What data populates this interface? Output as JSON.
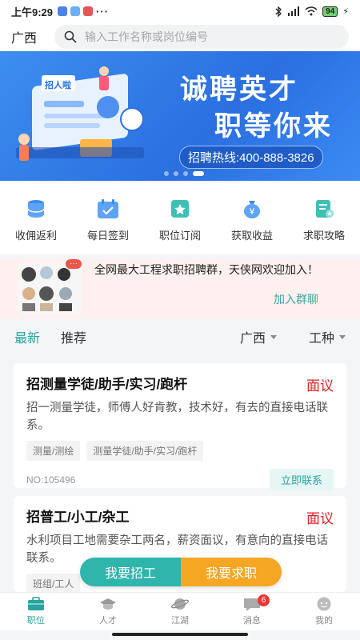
{
  "status_bar": {
    "time": "上午9:29",
    "battery": "94"
  },
  "header": {
    "city": "广西",
    "search_placeholder": "输入工作名称或岗位编号"
  },
  "banner": {
    "title_line1": "诚聘英才",
    "title_line2": "职等你来",
    "hotline": "招聘热线:400-888-3826",
    "illustration_sign": "招人啦"
  },
  "quick_menu": [
    {
      "label": "收佣返利",
      "icon": "database-icon",
      "color": "#3d8bf0"
    },
    {
      "label": "每日签到",
      "icon": "calendar-check-icon",
      "color": "#3d8bf0"
    },
    {
      "label": "职位订阅",
      "icon": "star-badge-icon",
      "color": "#2fb5ac"
    },
    {
      "label": "获取收益",
      "icon": "money-bag-icon",
      "color": "#3d8bf0"
    },
    {
      "label": "求职攻略",
      "icon": "document-star-icon",
      "color": "#2fb5ac"
    }
  ],
  "group_promo": {
    "text": "全网最大工程求职招聘群，天侠网欢迎加入！",
    "join_label": "加入群聊",
    "badge": "···"
  },
  "tabs": {
    "latest": "最新",
    "recommend": "推荐",
    "region_filter": "广西",
    "type_filter": "工种"
  },
  "jobs": [
    {
      "title": "招测量学徒/助手/实习/跑杆",
      "salary": "面议",
      "description": "招一测量学徒，师傅人好肯教，技术好，有去的直接电话联系。",
      "tags": [
        "测量/测绘",
        "测量学徒/助手/实习/跑杆"
      ],
      "number": "NO:105496",
      "contact_label": "立即联系"
    },
    {
      "title": "招普工/小工/杂工",
      "salary": "面议",
      "description": "水利项目工地需要杂工两名，薪资面议，有意向的直接电话联系。",
      "tags": [
        "班组/工人"
      ]
    }
  ],
  "fab": {
    "hire_label": "我要招工",
    "seek_label": "我要求职"
  },
  "tabbar": [
    {
      "label": "职位",
      "icon": "briefcase-icon",
      "active": true
    },
    {
      "label": "人才",
      "icon": "graduation-cap-icon"
    },
    {
      "label": "江湖",
      "icon": "planet-icon"
    },
    {
      "label": "消息",
      "icon": "chat-bubble-icon",
      "badge": "6"
    },
    {
      "label": "我的",
      "icon": "profile-icon"
    }
  ]
}
